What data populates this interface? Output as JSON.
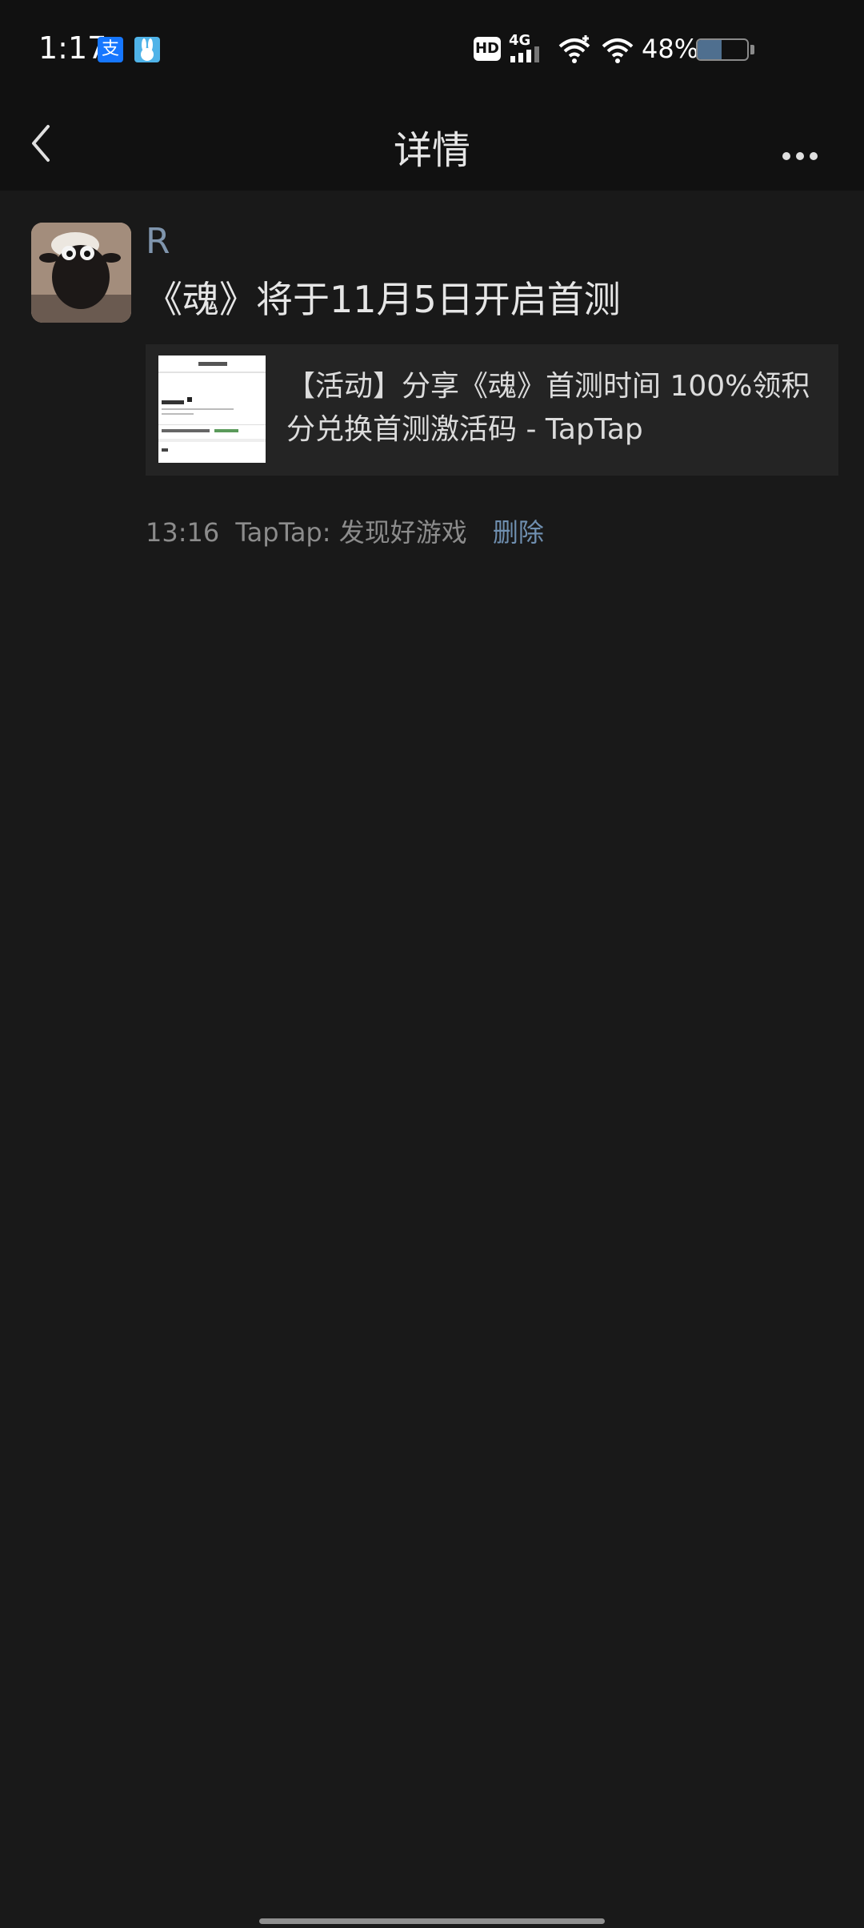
{
  "status_bar": {
    "time": "1:17",
    "hd_label": "HD",
    "network_label": "4G",
    "battery_percent": "48%",
    "battery_level": 0.48
  },
  "header": {
    "title": "详情"
  },
  "post": {
    "author": "R",
    "text": "《魂》将于11月5日开启首测",
    "link_card": {
      "title": "【活动】分享《魂》首测时间 100%领积分兑换首测激活码 - TapTap"
    },
    "time": "13:16",
    "source": "TapTap: 发现好游戏",
    "delete_label": "删除"
  },
  "colors": {
    "background": "#191919",
    "bar_background": "#111111",
    "author_name": "#7f95ad",
    "link_accent": "#6f8fb0"
  }
}
